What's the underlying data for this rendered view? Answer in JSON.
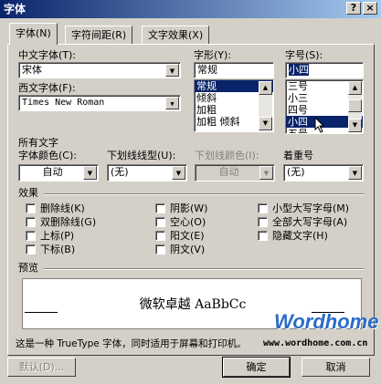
{
  "window": {
    "title": "字体",
    "help_label": "?",
    "close_label": "×"
  },
  "tabs": [
    {
      "label": "字体(N)"
    },
    {
      "label": "字符间距(R)"
    },
    {
      "label": "文字效果(X)"
    }
  ],
  "font": {
    "cn_font_label": "中文字体(T):",
    "cn_font_value": "宋体",
    "western_font_label": "西文字体(F):",
    "western_font_value": "Times New Roman",
    "style_label": "字形(Y):",
    "style_value": "常规",
    "style_options": [
      "常规",
      "倾斜",
      "加粗",
      "加粗 倾斜"
    ],
    "style_selected": "常规",
    "size_label": "字号(S):",
    "size_value": "小四",
    "size_options": [
      "三号",
      "小三",
      "四号",
      "小四",
      "五号"
    ],
    "size_selected": "小四"
  },
  "all_text": {
    "section_label": "所有文字",
    "color_label": "字体颜色(C):",
    "color_value": "自动",
    "underline_style_label": "下划线线型(U):",
    "underline_style_value": "(无)",
    "underline_color_label": "下划线颜色(I):",
    "underline_color_value": "自动",
    "emphasis_label": "着重号",
    "emphasis_value": "(无)"
  },
  "effects": {
    "section_label": "效果",
    "col1": [
      "删除线(K)",
      "双删除线(G)",
      "上标(P)",
      "下标(B)"
    ],
    "col2": [
      "阴影(W)",
      "空心(O)",
      "阳文(E)",
      "阴文(V)"
    ],
    "col3": [
      "小型大写字母(M)",
      "全部大写字母(A)",
      "隐藏文字(H)"
    ]
  },
  "preview": {
    "section_label": "预览",
    "sample_text": "微软卓越 AaBbCc",
    "description": "这是一种 TrueType 字体，同时适用于屏幕和打印机。"
  },
  "watermark": {
    "brand": "Wordhome",
    "url": "www.wordhome.com.cn"
  },
  "buttons": {
    "default_label": "默认(D)...",
    "ok_label": "确定",
    "cancel_label": "取消"
  },
  "colors": {
    "title_start": "#0a246a",
    "title_end": "#a6caf0",
    "selection": "#0a246a",
    "watermark": "#2a6cc8"
  }
}
